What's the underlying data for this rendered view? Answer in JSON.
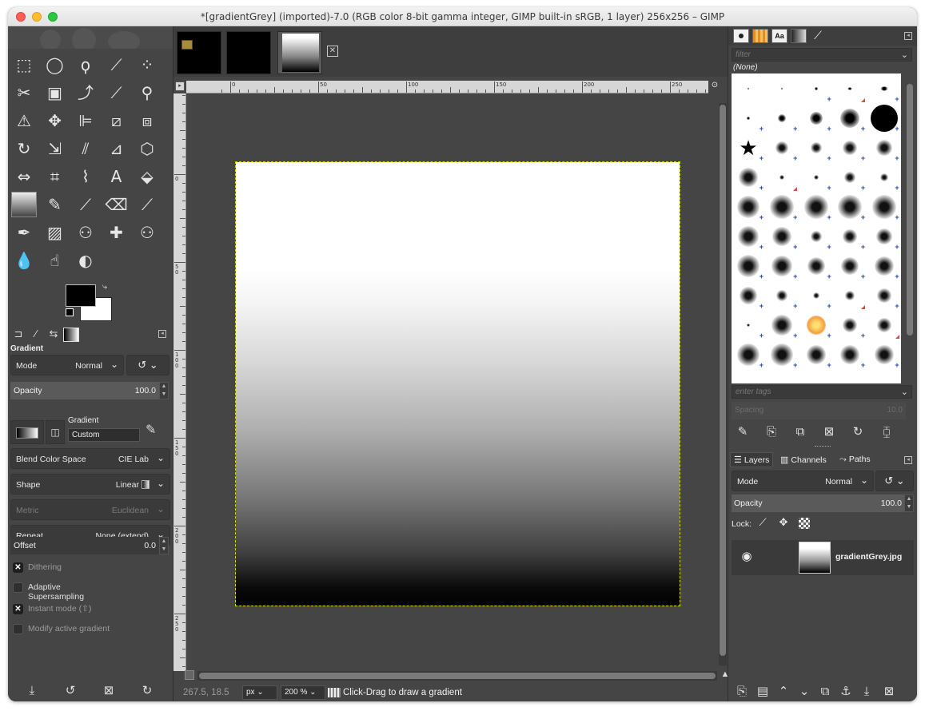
{
  "window": {
    "title": "*[gradientGrey] (imported)-7.0 (RGB color 8-bit gamma integer, GIMP built-in sRGB, 1 layer) 256x256 – GIMP"
  },
  "toolbox": {
    "tools": [
      {
        "name": "rect-select-tool",
        "glyph": "⬚"
      },
      {
        "name": "ellipse-select-tool",
        "glyph": "◯"
      },
      {
        "name": "free-select-tool",
        "glyph": "ϙ"
      },
      {
        "name": "fuzzy-select-tool",
        "glyph": "⟋"
      },
      {
        "name": "select-by-color-tool",
        "glyph": "⁘"
      },
      {
        "name": "scissors-tool",
        "glyph": "✂"
      },
      {
        "name": "foreground-select-tool",
        "glyph": "▣"
      },
      {
        "name": "paths-tool",
        "glyph": "⤴"
      },
      {
        "name": "color-picker-tool",
        "glyph": "⟋"
      },
      {
        "name": "zoom-tool",
        "glyph": "⚲"
      },
      {
        "name": "measure-tool",
        "glyph": "⚠"
      },
      {
        "name": "move-tool",
        "glyph": "✥"
      },
      {
        "name": "align-tool",
        "glyph": "⊫"
      },
      {
        "name": "crop-tool",
        "glyph": "⧄"
      },
      {
        "name": "unified-transform-tool",
        "glyph": "⧈"
      },
      {
        "name": "rotate-tool",
        "glyph": "↻"
      },
      {
        "name": "scale-tool",
        "glyph": "⇲"
      },
      {
        "name": "shear-tool",
        "glyph": "⫽"
      },
      {
        "name": "perspective-tool",
        "glyph": "⊿"
      },
      {
        "name": "3d-transform-tool",
        "glyph": "⬡"
      },
      {
        "name": "flip-tool",
        "glyph": "⇔"
      },
      {
        "name": "cage-transform-tool",
        "glyph": "⌗"
      },
      {
        "name": "warp-transform-tool",
        "glyph": "⌇"
      },
      {
        "name": "text-tool",
        "glyph": "A"
      },
      {
        "name": "bucket-fill-tool",
        "glyph": "⬙"
      },
      {
        "name": "gradient-tool",
        "glyph": "▒"
      },
      {
        "name": "pencil-tool",
        "glyph": "✎"
      },
      {
        "name": "paintbrush-tool",
        "glyph": "⟋"
      },
      {
        "name": "eraser-tool",
        "glyph": "⌫"
      },
      {
        "name": "airbrush-tool",
        "glyph": "⟋"
      },
      {
        "name": "ink-tool",
        "glyph": "✒"
      },
      {
        "name": "mypaint-brush-tool",
        "glyph": "▨"
      },
      {
        "name": "clone-tool",
        "glyph": "⚇"
      },
      {
        "name": "heal-tool",
        "glyph": "✚"
      },
      {
        "name": "perspective-clone-tool",
        "glyph": "⚇"
      },
      {
        "name": "blur-sharpen-tool",
        "glyph": "💧"
      },
      {
        "name": "smudge-tool",
        "glyph": "☝"
      },
      {
        "name": "dodge-burn-tool",
        "glyph": "◐"
      }
    ]
  },
  "tool_options": {
    "title": "Gradient",
    "mode": {
      "label": "Mode",
      "value": "Normal"
    },
    "opacity": {
      "label": "Opacity",
      "value": "100.0"
    },
    "gradient": {
      "label": "Gradient",
      "name": "Custom"
    },
    "blend_color_space": {
      "label": "Blend Color Space",
      "value": "CIE Lab"
    },
    "shape": {
      "label": "Shape",
      "value": "Linear"
    },
    "metric": {
      "label": "Metric",
      "value": "Euclidean"
    },
    "repeat": {
      "label": "Repeat",
      "value": "None (extend)"
    },
    "offset": {
      "label": "Offset",
      "value": "0.0"
    },
    "dithering": {
      "label": "Dithering",
      "checked": true
    },
    "adaptive": {
      "label": "Adaptive Supersampling",
      "checked": false
    },
    "instant": {
      "label": "Instant mode  (⇧)",
      "checked": true
    },
    "modify": {
      "label": "Modify active gradient",
      "checked": false
    }
  },
  "ruler": {
    "h": [
      "0",
      "50",
      "100",
      "150",
      "200",
      "250"
    ],
    "v": [
      "0",
      "50",
      "100",
      "150",
      "200",
      "250"
    ]
  },
  "status": {
    "coords": "267.5, 18.5",
    "unit": "px",
    "zoom": "200 %",
    "message": "Click-Drag to draw a gradient"
  },
  "brushes": {
    "filter_placeholder": "filter",
    "selected": "(None)",
    "tags_placeholder": "enter tags",
    "spacing": {
      "label": "Spacing",
      "value": "10.0"
    }
  },
  "layers": {
    "tabs": [
      "Layers",
      "Channels",
      "Paths"
    ],
    "mode": {
      "label": "Mode",
      "value": "Normal"
    },
    "opacity": {
      "label": "Opacity",
      "value": "100.0"
    },
    "lock_label": "Lock:",
    "items": [
      {
        "name": "gradientGrey.jpg"
      }
    ]
  }
}
